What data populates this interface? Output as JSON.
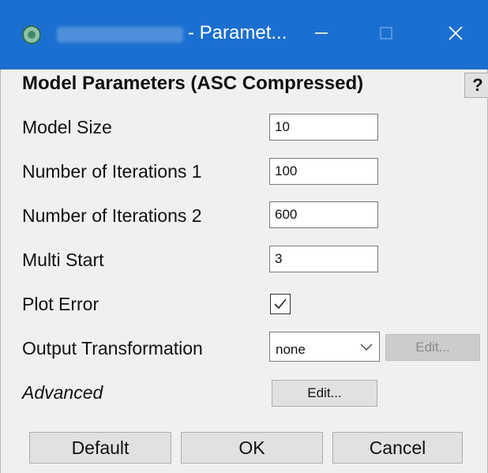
{
  "window": {
    "title_suffix": "- Paramet...",
    "app_icon": "app-icon",
    "controls": [
      "minimize-icon",
      "maximize-icon",
      "close-icon"
    ]
  },
  "dialog": {
    "heading": "Model Parameters (ASC Compressed)",
    "help_label": "?"
  },
  "params": {
    "model_size": {
      "label": "Model Size",
      "value": "10"
    },
    "iterations_1": {
      "label": "Number of Iterations 1",
      "value": "100"
    },
    "iterations_2": {
      "label": "Number of Iterations 2",
      "value": "600"
    },
    "multi_start": {
      "label": "Multi Start",
      "value": "3"
    },
    "plot_error": {
      "label": "Plot Error",
      "checked": true
    },
    "output_transformation": {
      "label": "Output Transformation",
      "selected": "none",
      "edit_label": "Edit..."
    },
    "advanced": {
      "label": "Advanced",
      "edit_label": "Edit..."
    }
  },
  "buttons": {
    "default": "Default",
    "ok": "OK",
    "cancel": "Cancel"
  },
  "colors": {
    "titlebar": "#1b6fd0",
    "panel": "#f0f0f0",
    "button": "#e1e1e1",
    "disabled_button": "#cccccc"
  }
}
